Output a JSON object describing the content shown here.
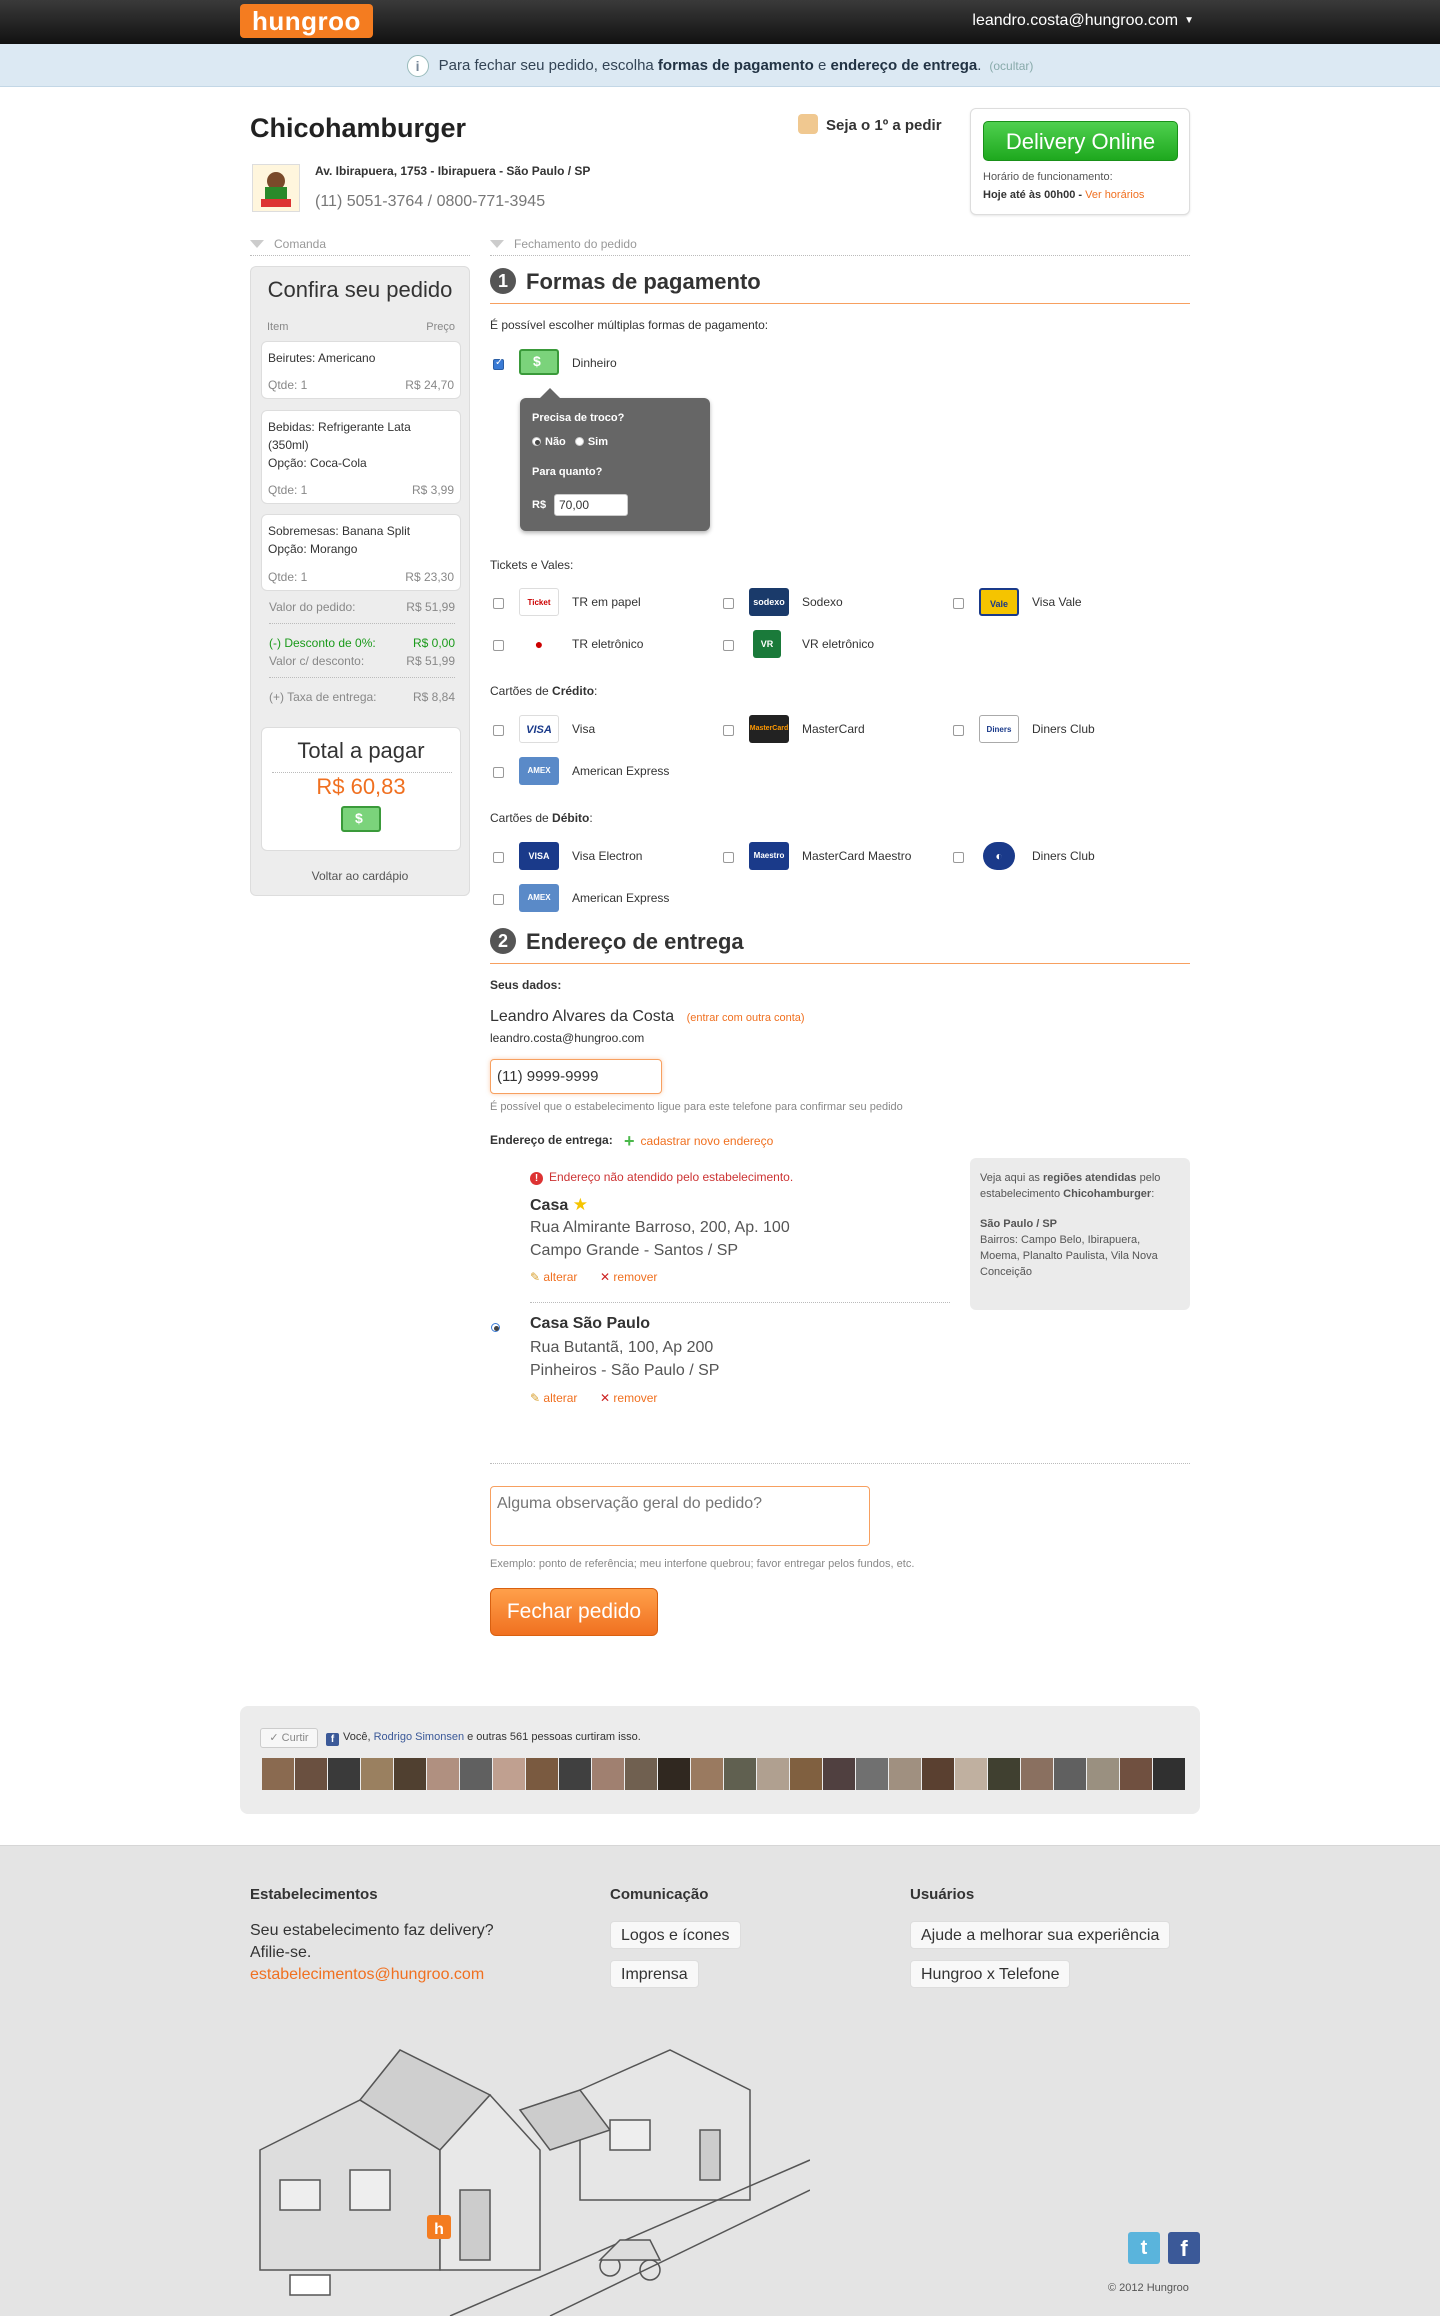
{
  "topbar": {
    "logo": "hungroo",
    "user_email": "leandro.costa@hungroo.com"
  },
  "infobar": {
    "text_pre": "Para fechar seu pedido, escolha ",
    "bold1": "formas de pagamento",
    "mid": " e ",
    "bold2": "endereço de entrega",
    "post": ".",
    "hide": "(ocultar)"
  },
  "restaurant": {
    "name": "Chicohamburger",
    "address": "Av. Ibirapuera, 1753 - Ibirapuera - São Paulo / SP",
    "phone": "(11) 5051-3764 / 0800-771-3945",
    "first_order": "Seja o 1º a pedir",
    "delivery_button": "Delivery Online",
    "hours_label": "Horário de funcionamento:",
    "hours": "Hoje até às 00h00",
    "hours_link": "Ver horários"
  },
  "sections": {
    "order": "Comanda",
    "checkout": "Fechamento do pedido"
  },
  "sidebar": {
    "title": "Confira seu pedido",
    "col_item": "Item",
    "col_price": "Preço",
    "items": [
      {
        "line1": "Beirutes: Americano",
        "line2": "",
        "line3": "",
        "qty": "Qtde: 1",
        "price": "R$ 24,70"
      },
      {
        "line1": "Bebidas: Refrigerante Lata",
        "line2": "(350ml)",
        "line3": "Opção: Coca-Cola",
        "qty": "Qtde: 1",
        "price": "R$ 3,99"
      },
      {
        "line1": "Sobremesas: Banana Split",
        "line2": "Opção: Morango",
        "line3": "",
        "qty": "Qtde: 1",
        "price": "R$ 23,30"
      }
    ],
    "subtotal_label": "Valor do pedido:",
    "subtotal": "R$ 51,99",
    "discount_label": "(-) Desconto de 0%:",
    "discount": "R$ 0,00",
    "after_discount_label": "Valor c/ desconto:",
    "after_discount": "R$ 51,99",
    "delivery_fee_label": "(+) Taxa de entrega:",
    "delivery_fee": "R$ 8,84",
    "total_label": "Total a pagar",
    "total": "R$ 60,83",
    "back": "Voltar ao cardápio"
  },
  "payment": {
    "step": "1",
    "title": "Formas de pagamento",
    "intro": "É possível escolher múltiplas formas de pagamento:",
    "cash": "Dinheiro",
    "change_question": "Precisa de troco?",
    "change_no": "Não",
    "change_yes": "Sim",
    "change_amount_label": "Para quanto?",
    "currency": "R$",
    "change_amount": "70,00",
    "tickets_label": "Tickets e Vales:",
    "tickets": [
      "TR em papel",
      "Sodexo",
      "Visa Vale",
      "TR eletrônico",
      "VR eletrônico"
    ],
    "credit_label_pre": "Cartões de ",
    "credit_label_bold": "Crédito",
    "credit_label_post": ":",
    "credit": [
      "Visa",
      "MasterCard",
      "Diners Club",
      "American Express"
    ],
    "debit_label_pre": "Cartões de ",
    "debit_label_bold": "Débito",
    "debit_label_post": ":",
    "debit": [
      "Visa Electron",
      "MasterCard Maestro",
      "Diners Club",
      "American Express"
    ],
    "logos": {
      "ticket": "Ticket",
      "sodexo": "sodexo",
      "visavale": "Vale",
      "vr": "VR",
      "visa": "VISA",
      "mc": "MasterCard",
      "diners": "Diners",
      "amex": "AMEX",
      "visaelectron": "VISA",
      "maestro": "Maestro"
    }
  },
  "address": {
    "step": "2",
    "title": "Endereço de entrega",
    "your_data": "Seus dados:",
    "user_name": "Leandro Alvares da Costa",
    "other_account": "(entrar com outra conta)",
    "user_email": "leandro.costa@hungroo.com",
    "phone": "(11) 9999-9999",
    "phone_note": "É possível que o estabelecimento ligue para este telefone para confirmar seu pedido",
    "delivery_label": "Endereço de entrega:",
    "new_address": "cadastrar novo endereço",
    "error": "Endereço não atendido pelo estabelecimento.",
    "list": [
      {
        "name": "Casa",
        "line1": "Rua Almirante Barroso, 200, Ap. 100",
        "line2": "Campo Grande - Santos / SP"
      },
      {
        "name": "Casa São Paulo",
        "line1": "Rua Butantã, 100, Ap 200",
        "line2": "Pinheiros - São Paulo / SP"
      }
    ],
    "edit": "alterar",
    "remove": "remover",
    "regions_pre": "Veja aqui as ",
    "regions_bold": "regiões atendidas",
    "regions_mid": " pelo estabelecimento ",
    "regions_name": "Chicohamburger",
    "regions_post": ":",
    "regions_city": "São Paulo / SP",
    "regions_neighborhoods": "Bairros: Campo Belo, Ibirapuera, Moema, Planalto Paulista, Vila Nova Conceição",
    "obs_placeholder": "Alguma observação geral do pedido?",
    "obs_example": "Exemplo: ponto de referência; meu interfone quebrou; favor entregar pelos fundos, etc.",
    "submit": "Fechar pedido"
  },
  "social": {
    "like": "✓ Curtir",
    "text_pre": "Você, ",
    "friend": "Rodrigo Simonsen",
    "text_post": " e outras 561 pessoas curtiram isso.",
    "face_colors": [
      "#8a6a50",
      "#6a5040",
      "#3a3a3a",
      "#9a8060",
      "#504030",
      "#b09080",
      "#606060",
      "#c0a090",
      "#7a5a40",
      "#404040",
      "#a08070",
      "#706050",
      "#302820",
      "#9a7a60",
      "#606050",
      "#b0a090",
      "#806040",
      "#504040",
      "#707070",
      "#a09080",
      "#5a4030",
      "#c0b0a0",
      "#404030",
      "#8a7060",
      "#606060",
      "#9a9080",
      "#705040",
      "#303030",
      "#b09070",
      "#605050",
      "#807060",
      "#a07050",
      "#505050",
      "#907060",
      "#403020",
      "#c0a080",
      "#606040",
      "#7a6a5a",
      "#a09090",
      "#4a3a2a"
    ]
  },
  "footer": {
    "col1_title": "Estabelecimentos",
    "col1_text1": "Seu estabelecimento faz delivery?",
    "col1_text2": "Afilie-se.",
    "col1_email": "estabelecimentos@hungroo.com",
    "col2_title": "Comunicação",
    "col2_links": [
      "Logos e ícones",
      "Imprensa"
    ],
    "col3_title": "Usuários",
    "col3_links": [
      "Ajude a melhorar sua experiência",
      "Hungroo x Telefone"
    ],
    "twitter": "t",
    "facebook": "f",
    "copyright": "© 2012 Hungroo"
  }
}
